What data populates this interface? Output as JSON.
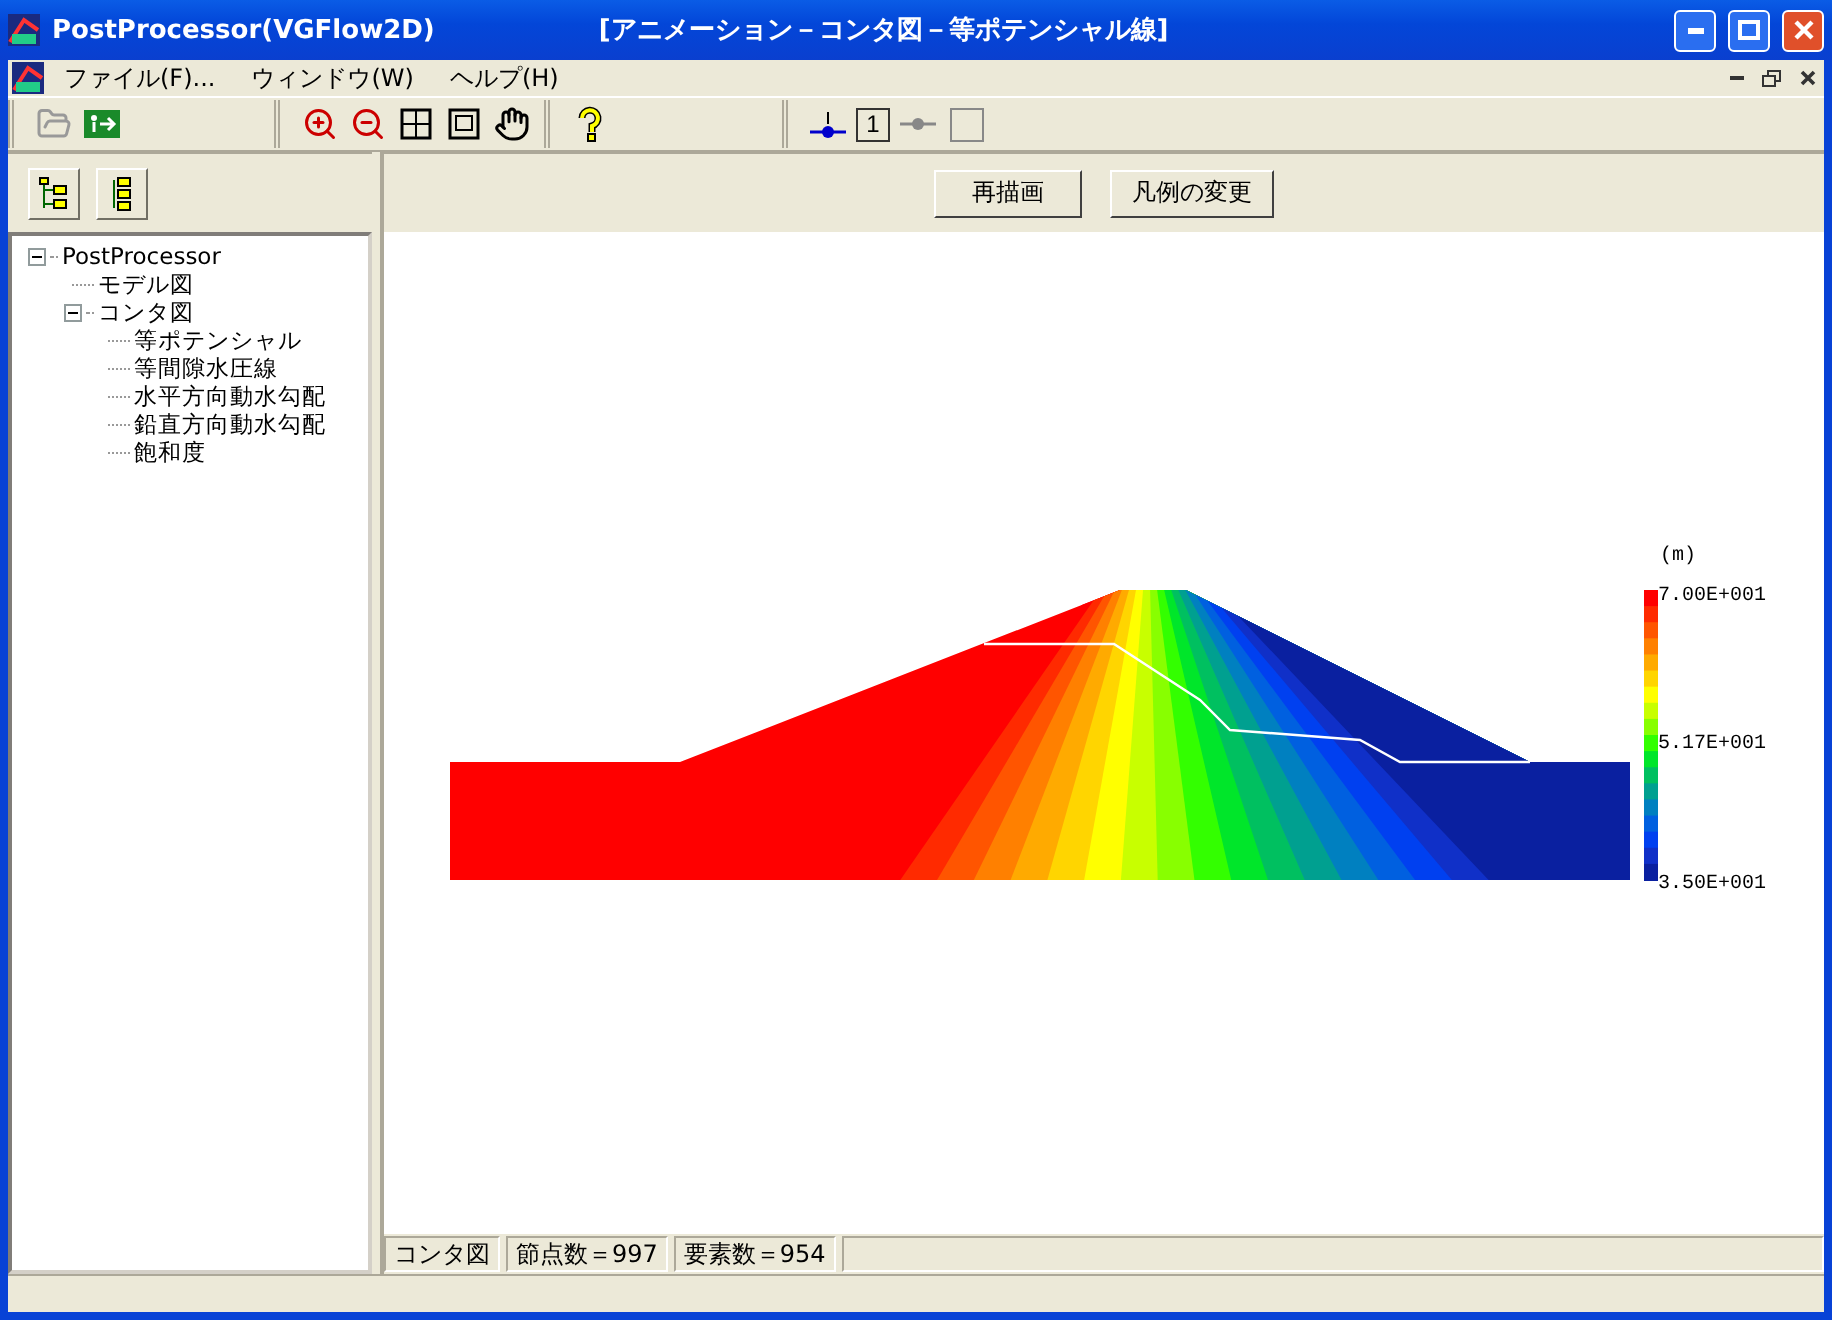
{
  "window": {
    "app_title": "PostProcessor(VGFlow2D)",
    "document_title": "[アニメーション－コンタ図－等ポテンシャル線]"
  },
  "menu": [
    {
      "label": "ファイル(F)..."
    },
    {
      "label": "ウィンドウ(W)"
    },
    {
      "label": "ヘルプ(H)"
    }
  ],
  "toolbar": {
    "number_box": "1"
  },
  "tree": [
    {
      "label": "PostProcessor",
      "expanded": true,
      "children": [
        {
          "label": "モデル図"
        },
        {
          "label": "コンタ図",
          "expanded": true,
          "children": [
            {
              "label": "等ポテンシャル"
            },
            {
              "label": "等間隙水圧線"
            },
            {
              "label": "水平方向動水勾配"
            },
            {
              "label": "鉛直方向動水勾配"
            },
            {
              "label": "飽和度"
            }
          ]
        }
      ]
    }
  ],
  "buttons": [
    "再描画",
    "凡例の変更"
  ],
  "legend": {
    "unit": "(m)",
    "max": "7.00E+001",
    "mid": "5.17E+001",
    "min": "3.50E+001"
  },
  "status_bar": [
    "コンタ図",
    "節点数＝997",
    "要素数＝954"
  ]
}
